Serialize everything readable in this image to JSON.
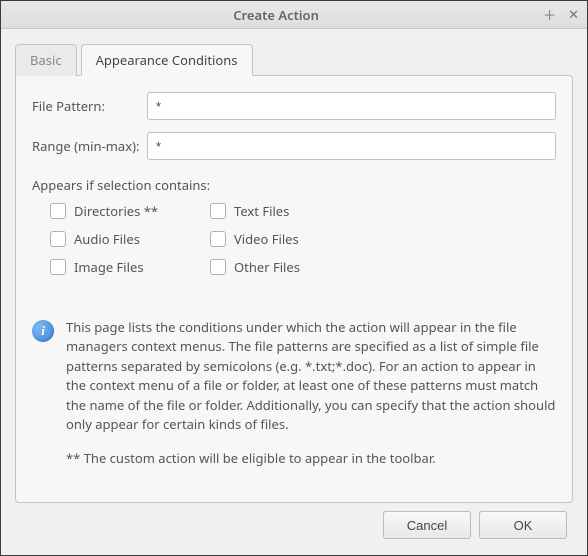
{
  "window": {
    "title": "Create Action"
  },
  "tabs": {
    "basic": "Basic",
    "appearance": "Appearance Conditions"
  },
  "form": {
    "file_pattern_label": "File Pattern:",
    "file_pattern_value": "*",
    "range_label": "Range (min-max):",
    "range_value": "*",
    "appears_label": "Appears if selection contains:"
  },
  "checks": {
    "directories": "Directories **",
    "text_files": "Text Files",
    "audio_files": "Audio Files",
    "video_files": "Video Files",
    "image_files": "Image Files",
    "other_files": "Other Files"
  },
  "info": {
    "main": "This page lists the conditions under which the action will appear in the file managers context menus. The file patterns are specified as a list of simple file patterns separated by semicolons (e.g. *.txt;*.doc). For an action to appear in the context menu of a file or folder, at least one of these patterns must match the name of the file or folder. Additionally, you can specify that the action should only appear for certain kinds of files.",
    "note": "** The custom action will be eligible to appear in the toolbar."
  },
  "buttons": {
    "cancel": "Cancel",
    "ok": "OK"
  }
}
